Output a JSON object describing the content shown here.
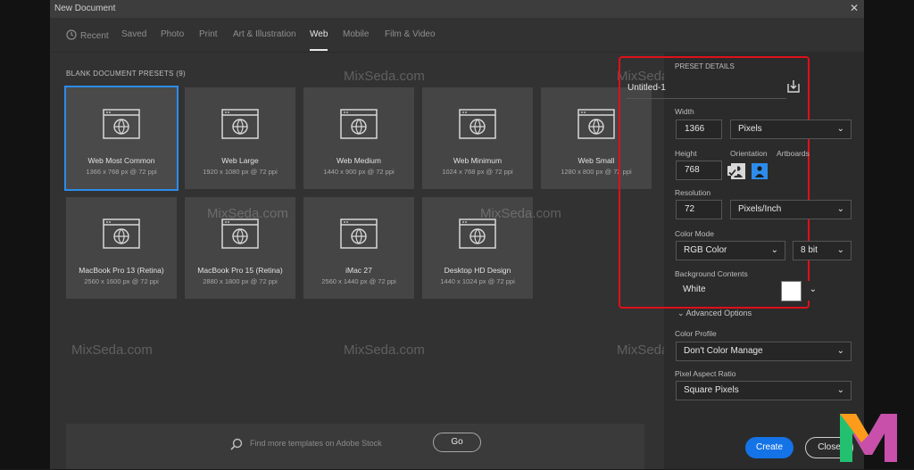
{
  "window": {
    "title": "New Document"
  },
  "tabs": [
    {
      "label": "Recent"
    },
    {
      "label": "Saved"
    },
    {
      "label": "Photo"
    },
    {
      "label": "Print"
    },
    {
      "label": "Art & Illustration"
    },
    {
      "label": "Web"
    },
    {
      "label": "Mobile"
    },
    {
      "label": "Film & Video"
    }
  ],
  "active_tab": "Web",
  "presets": {
    "heading": "BLANK DOCUMENT PRESETS",
    "count": "(9)",
    "items": [
      {
        "name": "Web Most Common",
        "spec": "1366 x 768 px @ 72 ppi",
        "selected": true
      },
      {
        "name": "Web Large",
        "spec": "1920 x 1080 px @ 72 ppi"
      },
      {
        "name": "Web Medium",
        "spec": "1440 x 900 px @ 72 ppi"
      },
      {
        "name": "Web Minimum",
        "spec": "1024 x 768 px @ 72 ppi"
      },
      {
        "name": "Web Small",
        "spec": "1280 x 800 px @ 72 ppi"
      },
      {
        "name": "MacBook Pro 13 (Retina)",
        "spec": "2560 x 1600 px @ 72 ppi"
      },
      {
        "name": "MacBook Pro 15 (Retina)",
        "spec": "2880 x 1800 px @ 72 ppi"
      },
      {
        "name": "iMac 27",
        "spec": "2560 x 1440 px @ 72 ppi"
      },
      {
        "name": "Desktop HD Design",
        "spec": "1440 x 1024 px @ 72 ppi"
      }
    ]
  },
  "stock_search": {
    "placeholder": "Find more templates on Adobe Stock",
    "go_label": "Go"
  },
  "details": {
    "heading": "PRESET DETAILS",
    "document_name": "Untitled-1",
    "width_label": "Width",
    "width_value": "1366",
    "width_unit": "Pixels",
    "height_label": "Height",
    "height_value": "768",
    "orientation_label": "Orientation",
    "artboards_label": "Artboards",
    "artboards_checked": true,
    "resolution_label": "Resolution",
    "resolution_value": "72",
    "resolution_unit": "Pixels/Inch",
    "color_mode_label": "Color Mode",
    "color_mode_value": "RGB Color",
    "bit_depth": "8 bit",
    "background_label": "Background Contents",
    "background_value": "White",
    "background_color": "#ffffff",
    "advanced_label": "Advanced Options",
    "color_profile_label": "Color Profile",
    "color_profile_value": "Don't Color Manage",
    "pixel_aspect_label": "Pixel Aspect Ratio",
    "pixel_aspect_value": "Square Pixels"
  },
  "buttons": {
    "create": "Create",
    "close": "Close"
  },
  "watermark": {
    "text": "MixSeda.com"
  },
  "colors": {
    "accent": "#2d8ceb",
    "highlight_box": "#e0101a",
    "create_button": "#1473e6"
  }
}
